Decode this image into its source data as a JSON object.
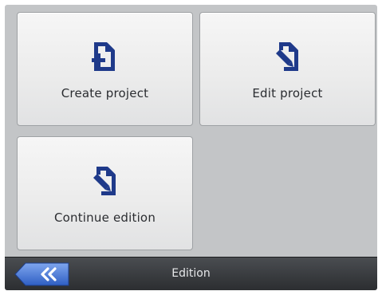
{
  "tiles": [
    {
      "id": "create",
      "label": "Create project",
      "icon": "new-file-icon"
    },
    {
      "id": "edit",
      "label": "Edit project",
      "icon": "edit-file-icon"
    },
    {
      "id": "continue",
      "label": "Continue edition",
      "icon": "edit-file-icon"
    }
  ],
  "bottombar": {
    "title": "Edition",
    "back_icon": "double-chevron-left-icon"
  },
  "colors": {
    "icon": "#1f3a8a",
    "background": "#c3c5c7",
    "bar": "#2b2d30",
    "back_button": "#3f6fd0"
  }
}
